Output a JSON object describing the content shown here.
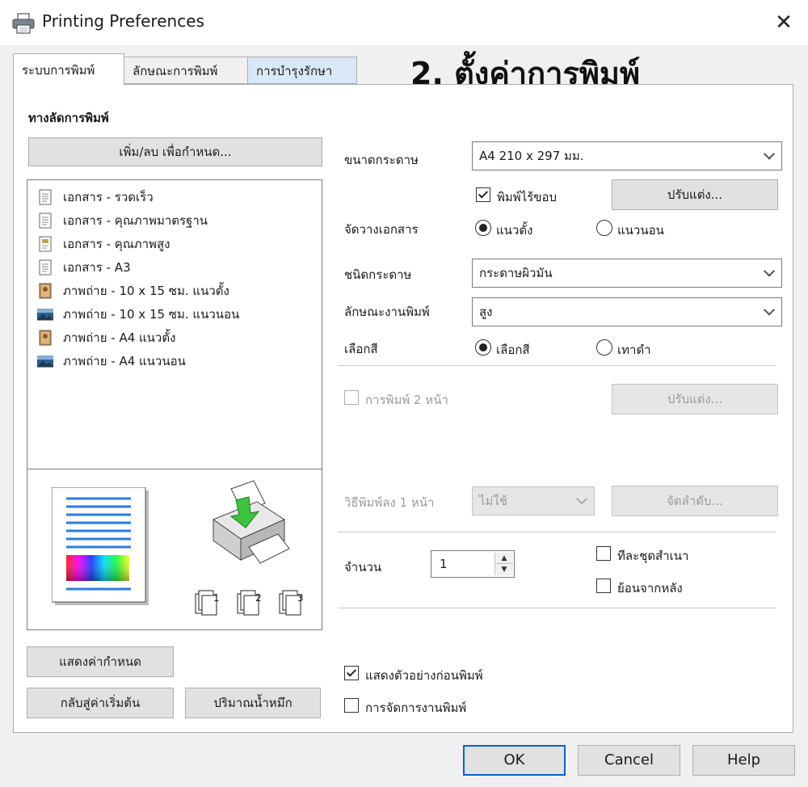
{
  "window": {
    "title": "Printing Preferences",
    "close_label": "✕"
  },
  "tabs": [
    {
      "label": "ระบบการพิมพ์"
    },
    {
      "label": "ลักษณะการพิมพ์"
    },
    {
      "label": "การบำรุงรักษา"
    }
  ],
  "step_heading": "2. ตั้งค่าการพิมพ์",
  "presets": {
    "title": "ทางลัดการพิมพ์",
    "add_remove_button": "เพิ่ม/ลบ เพื่อกำหนด...",
    "items": [
      {
        "label": "เอกสาร - รวดเร็ว",
        "icon": "document-icon"
      },
      {
        "label": "เอกสาร - คุณภาพมาตรฐาน",
        "icon": "document-icon"
      },
      {
        "label": "เอกสาร - คุณภาพสูง",
        "icon": "document-color-icon"
      },
      {
        "label": "เอกสาร - A3",
        "icon": "document-icon"
      },
      {
        "label": "ภาพถ่าย - 10 x 15 ซม. แนวตั้ง",
        "icon": "photo-portrait-icon"
      },
      {
        "label": "ภาพถ่าย - 10 x 15 ซม. แนวนอน",
        "icon": "photo-landscape-icon"
      },
      {
        "label": "ภาพถ่าย - A4 แนวตั้ง",
        "icon": "photo-portrait-icon"
      },
      {
        "label": "ภาพถ่าย - A4 แนวนอน",
        "icon": "photo-landscape-icon"
      }
    ]
  },
  "settings": {
    "paper_size_label": "ขนาดกระดาษ",
    "paper_size_value": "A4 210 x 297 มม.",
    "borderless_label": "พิมพ์ไร้ขอบ",
    "borderless_checked": true,
    "adjust_button": "ปรับแต่ง...",
    "orientation_label": "จัดวางเอกสาร",
    "orientation_portrait": "แนวตั้ง",
    "orientation_landscape": "แนวนอน",
    "paper_type_label": "ชนิดกระดาษ",
    "paper_type_value": "กระดาษผิวมัน",
    "quality_label": "ลักษณะงานพิมพ์",
    "quality_value": "สูง",
    "color_label": "เลือกสี",
    "color_option": "เลือกสี",
    "grayscale_option": "เทาดำ",
    "duplex_label": "การพิมพ์ 2 หน้า",
    "duplex_adjust_button": "ปรับแต่ง...",
    "multipage_label": "วิธีพิมพ์ลง 1 หน้า",
    "multipage_value": "ไม่ใช้",
    "page_order_button": "จัดลำดับ...",
    "copies_label": "จำนวน",
    "copies_value": "1",
    "collate_label": "ทีละชุดสำเนา",
    "reverse_label": "ย้อนจากหลัง",
    "print_preview_label": "แสดงตัวอย่างก่อนพิมพ์",
    "print_preview_checked": true,
    "job_arranger_label": "การจัดการงานพิมพ์"
  },
  "left_buttons": {
    "show_settings": "แสดงค่ากำหนด",
    "reset_defaults": "กลับสู่ค่าเริ่มต้น",
    "ink_levels": "ปริมาณน้ำหมึก"
  },
  "preview": {
    "copy_numbers": [
      "1",
      "2",
      "3"
    ]
  },
  "footer": {
    "ok": "OK",
    "cancel": "Cancel",
    "help": "Help"
  },
  "colors": {
    "accent_blue": "#0a63c9",
    "maint_tab_bg": "#d9e8f7",
    "preview_line_blue": "#2a7de1"
  }
}
